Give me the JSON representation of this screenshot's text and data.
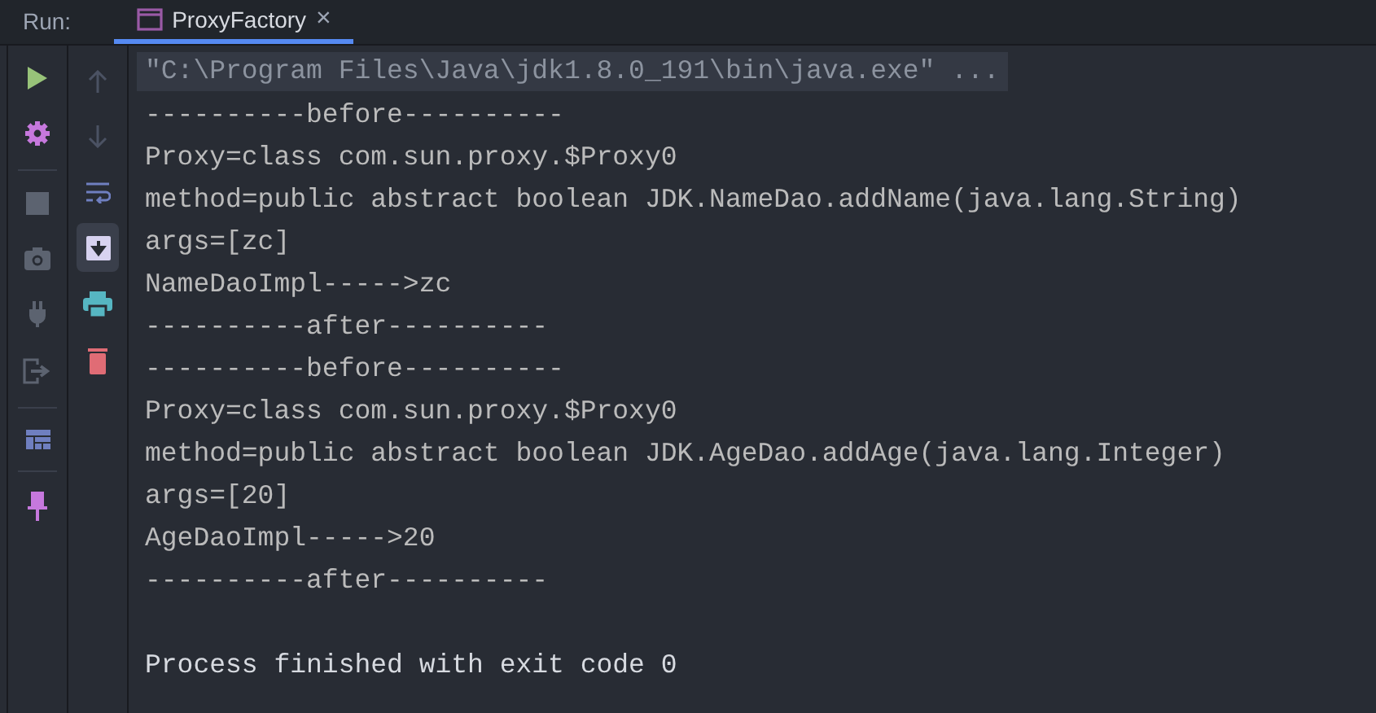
{
  "run_panel": {
    "label": "Run:",
    "tabs": [
      {
        "title": "ProxyFactory",
        "selected": true,
        "close": "×"
      }
    ]
  },
  "console_toolbar": {
    "buttons": [
      {
        "active": false
      },
      {
        "active": false
      },
      {
        "active": false
      },
      {
        "active": true
      },
      {
        "active": false
      },
      {
        "active": false
      }
    ]
  },
  "console": {
    "lines": [
      {
        "kind": "command",
        "text": "\"C:\\Program Files\\Java\\jdk1.8.0_191\\bin\\java.exe\" ..."
      },
      {
        "kind": "output",
        "text": "----------before----------"
      },
      {
        "kind": "output",
        "text": "Proxy=class com.sun.proxy.$Proxy0"
      },
      {
        "kind": "output",
        "text": "method=public abstract boolean JDK.NameDao.addName(java.lang.String)"
      },
      {
        "kind": "output",
        "text": "args=[zc]"
      },
      {
        "kind": "output",
        "text": "NameDaoImpl----->zc"
      },
      {
        "kind": "output",
        "text": "----------after----------"
      },
      {
        "kind": "output",
        "text": "----------before----------"
      },
      {
        "kind": "output",
        "text": "Proxy=class com.sun.proxy.$Proxy0"
      },
      {
        "kind": "output",
        "text": "method=public abstract boolean JDK.AgeDao.addAge(java.lang.Integer)"
      },
      {
        "kind": "output",
        "text": "args=[20]"
      },
      {
        "kind": "output",
        "text": "AgeDaoImpl----->20"
      },
      {
        "kind": "output",
        "text": "----------after----------"
      },
      {
        "kind": "exit",
        "text": "Process finished with exit code 0"
      }
    ]
  }
}
